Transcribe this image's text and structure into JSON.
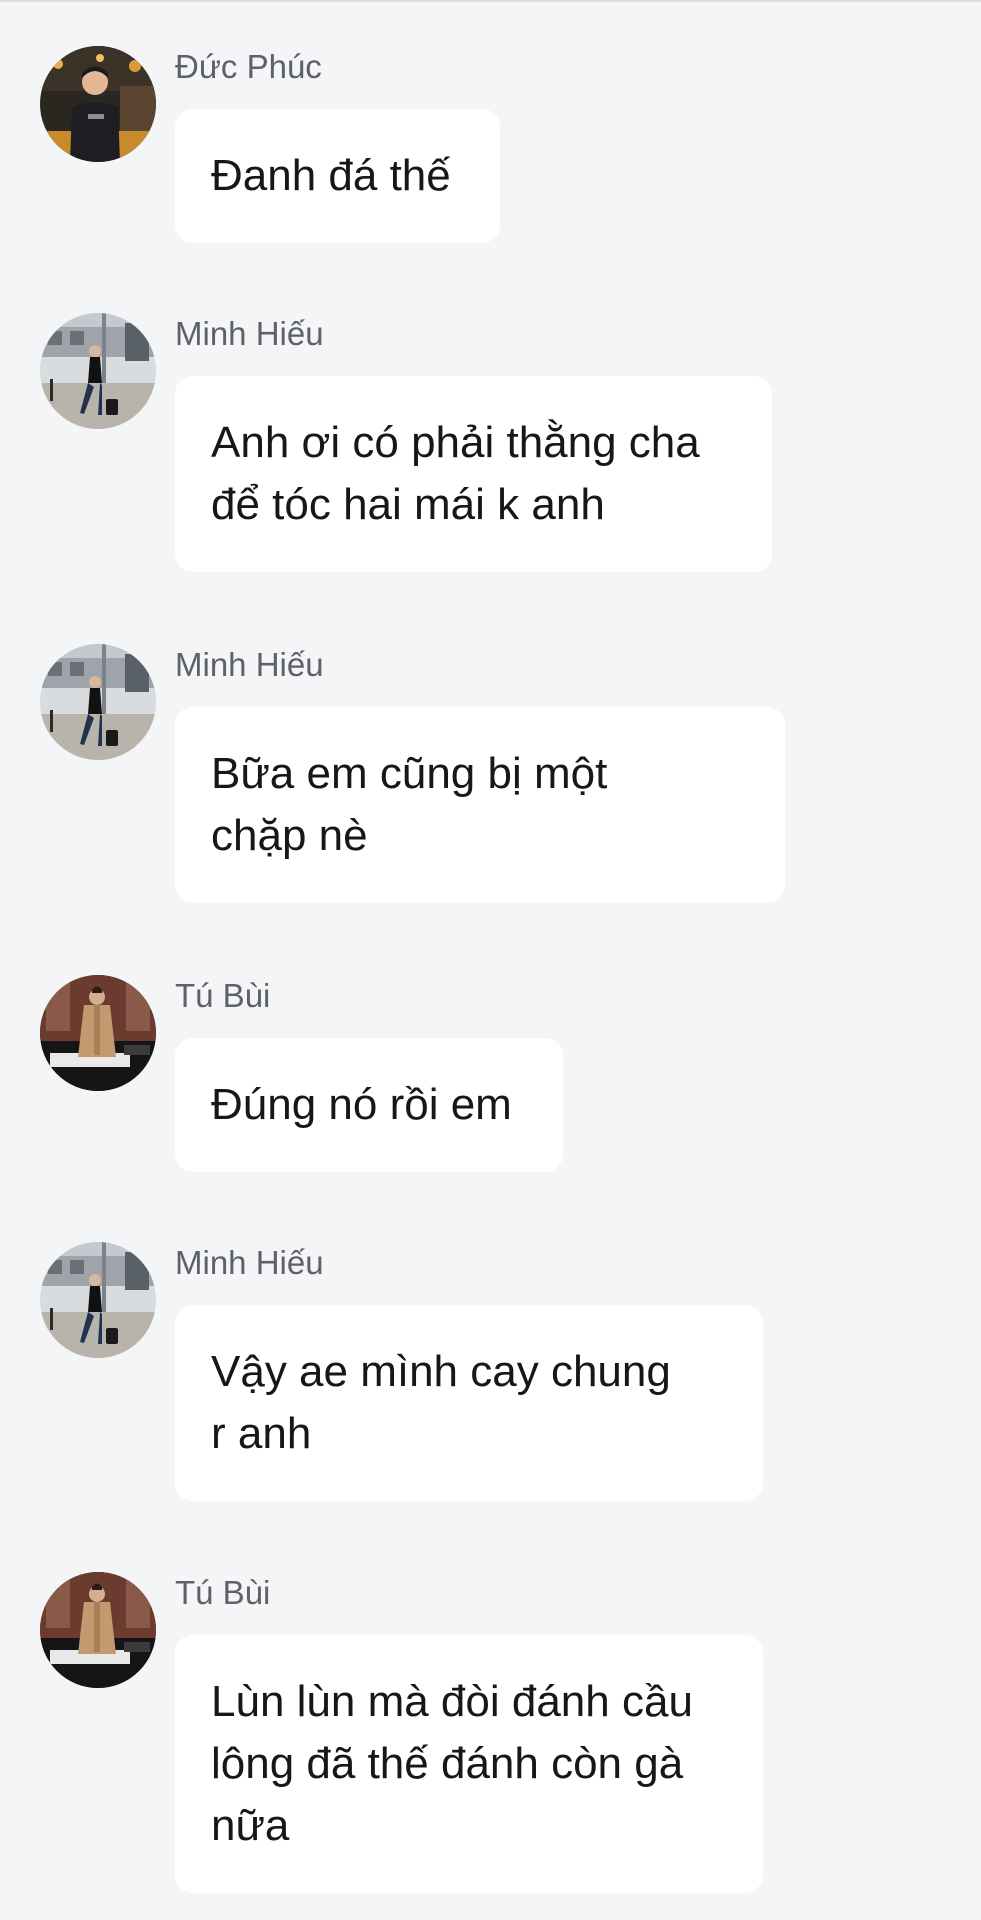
{
  "messages": [
    {
      "sender": "Đức Phúc",
      "avatar": "avatar-duc-phuc",
      "text": "Đanh đá thế"
    },
    {
      "sender": "Minh Hiếu",
      "avatar": "avatar-minh-hieu",
      "text": "Anh ơi có phải thằng cha\nđể tóc hai mái k anh"
    },
    {
      "sender": "Minh Hiếu",
      "avatar": "avatar-minh-hieu",
      "text": "Bữa em cũng bị một\nchặp nè"
    },
    {
      "sender": "Tú Bùi",
      "avatar": "avatar-tu-bui",
      "text": "Đúng nó rồi em"
    },
    {
      "sender": "Minh Hiếu",
      "avatar": "avatar-minh-hieu",
      "text": "Vậy ae mình cay chung\nr anh"
    },
    {
      "sender": "Tú Bùi",
      "avatar": "avatar-tu-bui",
      "text": "Lùn lùn mà đòi đánh cầu\nlông đã thế đánh còn gà\nnữa"
    }
  ],
  "colors": {
    "background": "#f4f5f7",
    "bubble": "#ffffff",
    "sender_name": "#5e6168",
    "message_text": "#15171a"
  }
}
